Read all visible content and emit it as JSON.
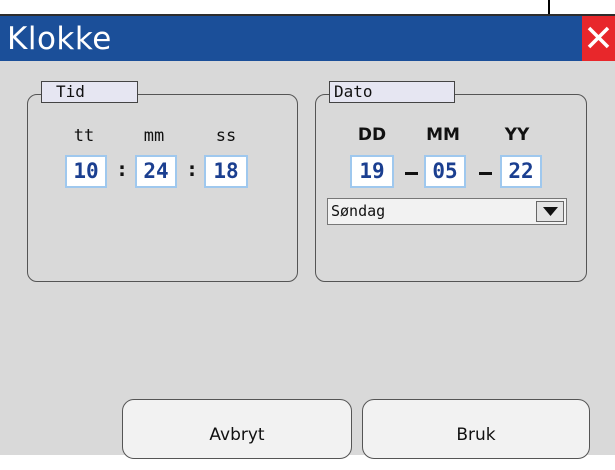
{
  "window": {
    "title": "Klokke"
  },
  "time_group": {
    "legend": "Tid",
    "headers": [
      "tt",
      "mm",
      "ss"
    ],
    "values": [
      "10",
      "24",
      "18"
    ],
    "separator": ":"
  },
  "date_group": {
    "legend": "Dato",
    "headers": [
      "DD",
      "MM",
      "YY"
    ],
    "values": [
      "19",
      "05",
      "22"
    ],
    "weekday_selected": "Søndag"
  },
  "buttons": {
    "cancel": "Avbryt",
    "apply": "Bruk"
  },
  "colors": {
    "titlebar": "#1b4f99",
    "close": "#e8272b",
    "background": "#d9d9d9",
    "field_border": "#9fc8ee"
  }
}
